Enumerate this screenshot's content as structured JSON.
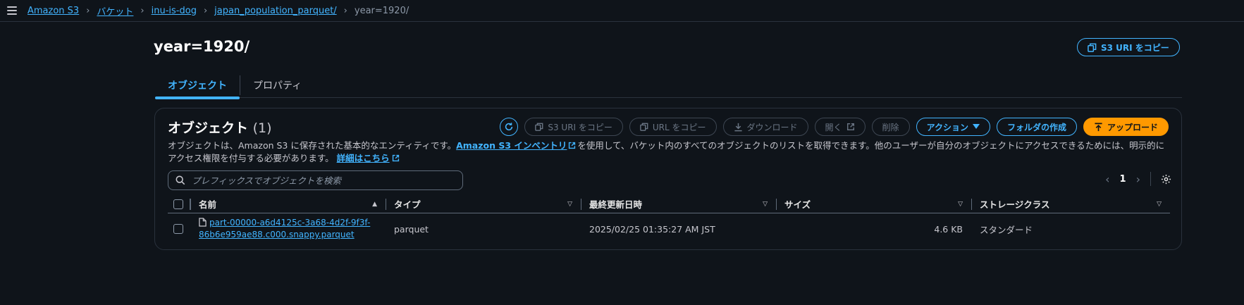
{
  "breadcrumb": {
    "items": [
      "Amazon S3",
      "バケット",
      "inu-is-dog",
      "japan_population_parquet/"
    ],
    "current": "year=1920/"
  },
  "page": {
    "title": "year=1920/",
    "copy_uri_label": "S3 URI をコピー"
  },
  "tabs": [
    "オブジェクト",
    "プロパティ"
  ],
  "objects": {
    "title": "オブジェクト",
    "count": "(1)",
    "toolbar": {
      "copy_s3_uri": "S3 URI をコピー",
      "copy_url": "URL をコピー",
      "download": "ダウンロード",
      "open": "開く",
      "delete": "削除",
      "actions": "アクション",
      "create_folder": "フォルダの作成",
      "upload": "アップロード"
    },
    "description": {
      "part1": "オブジェクトは、Amazon S3 に保存された基本的なエンティティです。",
      "link1": "Amazon S3 インベントリ",
      "part2": "を使用して、バケット内のすべてのオブジェクトのリストを取得できます。他のユーザーが自分のオブジェクトにアクセスできるためには、明示的にアクセス権限を付与する必要があります。",
      "link2": "詳細はこちら"
    },
    "search_placeholder": "プレフィックスでオブジェクトを検索",
    "pagination": {
      "current_page": "1"
    },
    "columns": [
      "名前",
      "タイプ",
      "最終更新日時",
      "サイズ",
      "ストレージクラス"
    ],
    "rows": [
      {
        "name": "part-00000-a6d4125c-3a68-4d2f-9f3f-86b6e959ae88.c000.snappy.parquet",
        "type": "parquet",
        "modified": "2025/02/25 01:35:27 AM JST",
        "size": "4.6 KB",
        "storage_class": "スタンダード"
      }
    ]
  },
  "colors": {
    "background": "#0f141a",
    "link": "#42b4ff",
    "primary_button": "#ff9900",
    "border": "#2a323d"
  },
  "icons": [
    "menu-icon",
    "copy-icon",
    "refresh-icon",
    "download-icon",
    "external-link-icon",
    "caret-down-icon",
    "upload-icon",
    "search-icon",
    "chevron-left-icon",
    "chevron-right-icon",
    "gear-icon",
    "file-icon",
    "sort-ascending-icon",
    "sort-descending-icon"
  ]
}
